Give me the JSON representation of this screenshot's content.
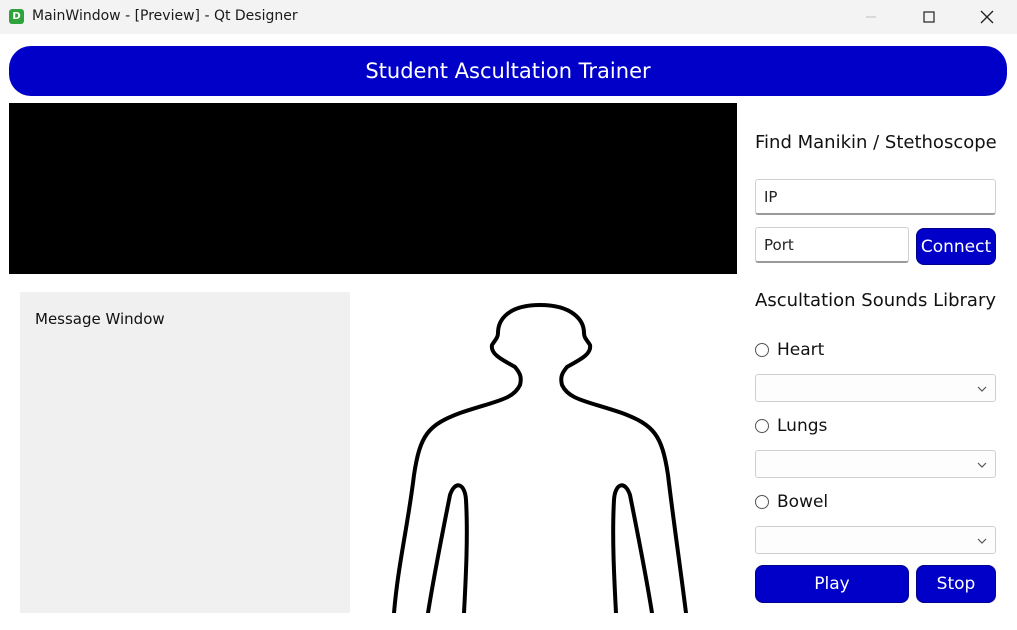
{
  "window": {
    "title": "MainWindow - [Preview] - Qt Designer",
    "app_icon_letter": "D"
  },
  "header": {
    "title": "Student Ascultation Trainer"
  },
  "message_window": {
    "label": "Message Window"
  },
  "connection": {
    "title": "Find Manikin / Stethoscope",
    "ip_placeholder": "IP",
    "ip_value": "",
    "port_placeholder": "Port",
    "port_value": "",
    "connect_label": "Connect"
  },
  "library": {
    "title": "Ascultation Sounds Library",
    "options": [
      {
        "label": "Heart",
        "selected": false,
        "combo_value": ""
      },
      {
        "label": "Lungs",
        "selected": false,
        "combo_value": ""
      },
      {
        "label": "Bowel",
        "selected": false,
        "combo_value": ""
      }
    ],
    "play_label": "Play",
    "stop_label": "Stop"
  },
  "colors": {
    "accent": "#0000c8",
    "video_background": "#000000",
    "message_background": "#f0f0f0"
  },
  "icons": [
    "app-icon",
    "minimize-icon",
    "maximize-icon",
    "close-icon",
    "chevron-down-icon",
    "body-outline"
  ]
}
